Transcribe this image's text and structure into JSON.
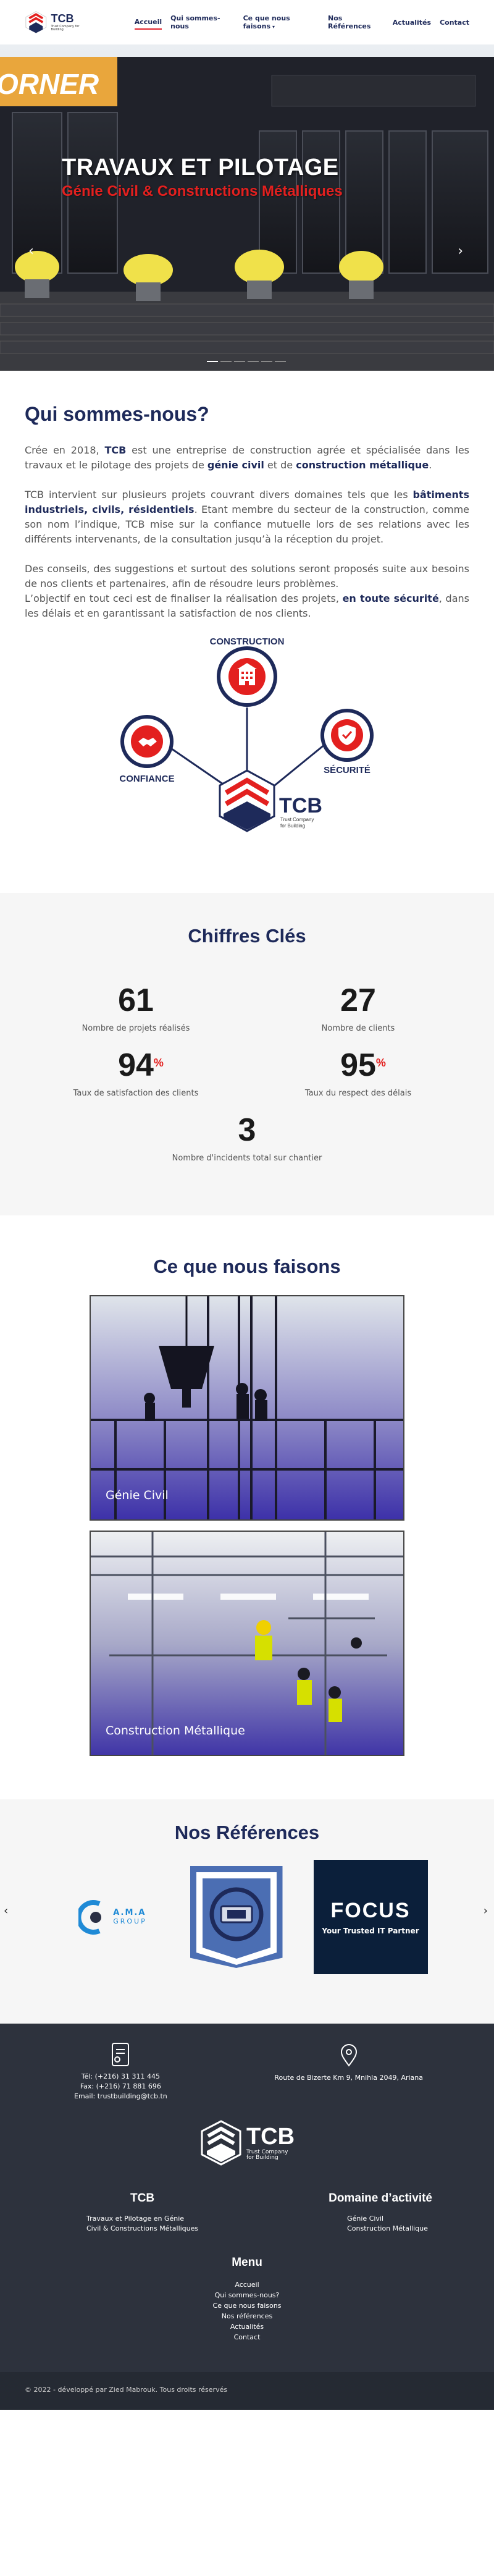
{
  "header": {
    "logo_text": "TCB",
    "logo_sub": "Trust Company for Building",
    "nav": [
      {
        "label": "Accueil",
        "active": true
      },
      {
        "label": "Qui sommes-nous"
      },
      {
        "label": "Ce que nous faisons",
        "caret": "▾"
      },
      {
        "label": "Nos Références"
      },
      {
        "label": "Actualités"
      },
      {
        "label": "Contact"
      }
    ]
  },
  "hero": {
    "title": "TRAVAUX ET PILOTAGE",
    "subtitle": "Génie Civil & Constructions Métalliques",
    "sign_text": "ORNER",
    "prev": "‹",
    "next": "›"
  },
  "about": {
    "title": "Qui sommes-nous?",
    "p1": [
      "Crée en 2018, ",
      "TCB",
      " est une entreprise de construction agrée et spécialisée dans les travaux et le pilotage des projets de ",
      "génie civil",
      " et de ",
      "construction métallique",
      "."
    ],
    "p2": [
      "TCB intervient sur plusieurs projets couvrant divers domaines tels que les ",
      "bâtiments industriels, civils, résidentiels",
      ". Etant membre du secteur de la construction, comme son nom l’indique, TCB mise sur la confiance mutuelle lors de ses relations avec les différents intervenants, de la consultation jusqu’à la réception du projet."
    ],
    "p3": [
      "Des conseils, des suggestions et surtout des solutions seront proposés suite aux besoins de nos clients et partenaires, afin de résoudre leurs problèmes.",
      "L’objectif en tout ceci est de finaliser la réalisation des projets, ",
      "en toute sécurité",
      ", dans les délais et en garantissant la satisfaction de nos clients."
    ],
    "diagram": {
      "construction": "CONSTRUCTION",
      "confiance": "CONFIANCE",
      "securite": "SÉCURITÉ",
      "tcb": "TCB",
      "tcb_sub1": "Trust Company",
      "tcb_sub2": "for Building"
    }
  },
  "stats": {
    "title": "Chiffres Clés",
    "items": [
      {
        "value": "61",
        "label": "Nombre de projets réalisés"
      },
      {
        "value": "27",
        "label": "Nombre de clients"
      },
      {
        "value": "94",
        "suffix": "%",
        "label": "Taux de satisfaction des clients"
      },
      {
        "value": "95",
        "suffix": "%",
        "label": "Taux du respect des délais"
      },
      {
        "value": "3",
        "label": "Nombre d'incidents total sur chantier"
      }
    ]
  },
  "services": {
    "title": "Ce que nous faisons",
    "items": [
      {
        "label": "Génie Civil"
      },
      {
        "label": "Construction Métallique"
      }
    ]
  },
  "references": {
    "title": "Nos Références",
    "logos": [
      {
        "name": "A.M.A",
        "sub": "GROUP"
      },
      {
        "name": "emblem"
      },
      {
        "name": "FOCUS",
        "sub": "Your Trusted IT Partner"
      }
    ],
    "prev": "‹",
    "next": "›"
  },
  "footer": {
    "tel": "Tél: (+216) 31 311 445",
    "fax": "Fax: (+216) 71 881 696",
    "email": "Email: trustbuilding@tcb.tn",
    "address": "Route de Bizerte Km 9, Mnihla 2049, Ariana",
    "logo_text": "TCB",
    "logo_sub1": "Trust Company",
    "logo_sub2": "for Building",
    "col1_title": "TCB",
    "col1_items": [
      "Travaux et Pilotage en Génie",
      "Civil & Constructions Métalliques"
    ],
    "col2_title": "Domaine d’activité",
    "col2_items": [
      "Génie Civil",
      "Construction Métallique"
    ],
    "menu_title": "Menu",
    "menu_items": [
      "Accueil",
      "Qui sommes-nous?",
      "Ce que nous faisons",
      "Nos références",
      "Actualités",
      "Contact"
    ],
    "copyright": "© 2022 - développé par Zied Mabrouk. Tous droits réservés"
  },
  "colors": {
    "navy": "#1e2a5a",
    "red": "#e3201f",
    "footer_bg": "#2d323d"
  }
}
